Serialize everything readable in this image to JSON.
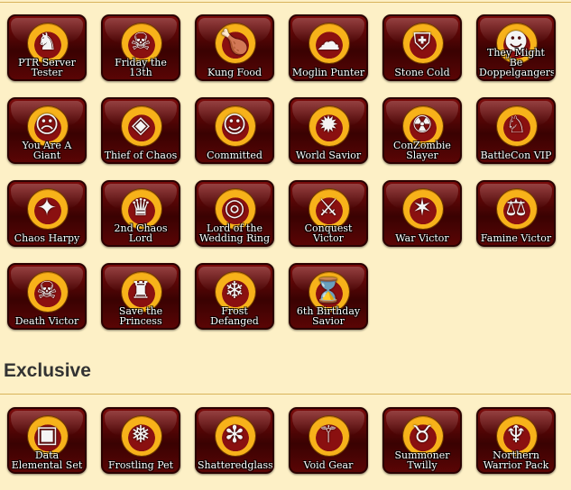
{
  "badges": [
    {
      "label": "PTR Server Tester",
      "icon": "robot-knight-icon",
      "glyph": "♞"
    },
    {
      "label": "Friday the 13th",
      "icon": "skull-13-icon",
      "glyph": "☠"
    },
    {
      "label": "Kung Food",
      "icon": "roast-turkey-icon",
      "glyph": "🍗"
    },
    {
      "label": "Moglin Punter",
      "icon": "moglin-cloud-icon",
      "glyph": "☁"
    },
    {
      "label": "Stone Cold",
      "icon": "horned-helm-icon",
      "glyph": "⛨"
    },
    {
      "label": "They Might Be Doppelgangers!",
      "icon": "twin-faces-icon",
      "glyph": "☻"
    },
    {
      "label": "You Are A Giant",
      "icon": "giant-face-icon",
      "glyph": "☹"
    },
    {
      "label": "Thief of Chaos",
      "icon": "chaos-gems-icon",
      "glyph": "◈"
    },
    {
      "label": "Committed",
      "icon": "girl-portrait-icon",
      "glyph": "☺"
    },
    {
      "label": "World Savior",
      "icon": "dark-beast-icon",
      "glyph": "✹"
    },
    {
      "label": "ConZombie Slayer",
      "icon": "zombie-head-icon",
      "glyph": "☢"
    },
    {
      "label": "BattleCon VIP",
      "icon": "unicorn-icon",
      "glyph": "♘"
    },
    {
      "label": "Chaos Harpy",
      "icon": "harpy-icon",
      "glyph": "✦"
    },
    {
      "label": "2nd Chaos Lord",
      "icon": "chaos-lord-icon",
      "glyph": "♛"
    },
    {
      "label": "Lord of the Wedding Ring",
      "icon": "wedding-ring-icon",
      "glyph": "◎"
    },
    {
      "label": "Conquest Victor",
      "icon": "crossed-swords-icon",
      "glyph": "⚔"
    },
    {
      "label": "War Victor",
      "icon": "war-mask-icon",
      "glyph": "✶"
    },
    {
      "label": "Famine Victor",
      "icon": "scales-icon",
      "glyph": "⚖"
    },
    {
      "label": "Death Victor",
      "icon": "reaper-icon",
      "glyph": "☠"
    },
    {
      "label": "Save the Princess",
      "icon": "dragon-head-icon",
      "glyph": "♜"
    },
    {
      "label": "Frost Defanged",
      "icon": "frost-dragon-icon",
      "glyph": "❄"
    },
    {
      "label": "6th Birthday Savior",
      "icon": "hourglass-maiden-icon",
      "glyph": "⌛"
    }
  ],
  "exclusive_heading": "Exclusive",
  "exclusive_badges": [
    {
      "label": "Data Elemental Set",
      "icon": "data-elemental-icon",
      "glyph": "▣"
    },
    {
      "label": "Frostling Pet",
      "icon": "frostling-pet-icon",
      "glyph": "❅"
    },
    {
      "label": "Shatteredglass",
      "icon": "snowflake-icon",
      "glyph": "✻"
    },
    {
      "label": "Void Gear",
      "icon": "void-blade-icon",
      "glyph": "⚚"
    },
    {
      "label": "Summoner Twilly",
      "icon": "twilly-icon",
      "glyph": "♉"
    },
    {
      "label": "Northern Warrior Pack",
      "icon": "ice-warrior-icon",
      "glyph": "♆"
    }
  ]
}
